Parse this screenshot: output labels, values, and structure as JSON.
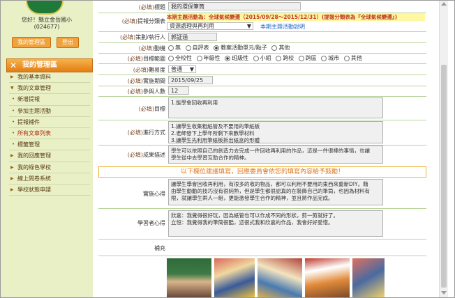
{
  "user": {
    "greeting": "您好！縣立金岳國小",
    "id": "(024677)"
  },
  "buttons": {
    "admin": "我的管理區",
    "logout": "登出"
  },
  "menu": {
    "title": "我的管理區",
    "items": [
      {
        "label": "我的基本資料",
        "type": "arrow",
        "color": "normal"
      },
      {
        "label": "我的文章管理",
        "type": "arrow-down",
        "color": "normal"
      },
      {
        "label": "新增提報",
        "type": "dot",
        "color": "normal"
      },
      {
        "label": "參加主題活動",
        "type": "dot",
        "color": "normal"
      },
      {
        "label": "提報補件",
        "type": "dot",
        "color": "normal"
      },
      {
        "label": "所有文章列表",
        "type": "dot",
        "color": "red"
      },
      {
        "label": "標籤管理",
        "type": "dot",
        "color": "normal"
      },
      {
        "label": "我的回應管理",
        "type": "arrow",
        "color": "normal"
      },
      {
        "label": "我的綠色學校",
        "type": "arrow",
        "color": "normal"
      },
      {
        "label": "線上問卷系統",
        "type": "arrow",
        "color": "normal"
      },
      {
        "label": "學校狀態申請",
        "type": "arrow",
        "color": "normal"
      }
    ]
  },
  "req": "(必填)",
  "form": {
    "title": {
      "label": "標題",
      "value": "我的環保筆筒"
    },
    "category": {
      "label": "提報分類表",
      "notice": "本期主題活動為：全球氣候變遷（2015/09/28～2015/12/31）(提報分類表為『全球氣候變遷』)",
      "select": "資源處理與再利用",
      "link": "本期主題活動說明"
    },
    "planner": {
      "label": "策劃/執行人",
      "value": "郭証涵"
    },
    "motive": {
      "label": "動機",
      "options": [
        "無",
        "自評表",
        "教案活動單元/點子",
        "其他"
      ],
      "selected": 2
    },
    "scope": {
      "label": "目標範圍",
      "options": [
        "全校性",
        "年級性",
        "班級性",
        "小組",
        "跨校",
        "跨區",
        "城市",
        "其他"
      ],
      "selected": 2
    },
    "difficulty": {
      "label": "難易度",
      "value": "普通"
    },
    "date": {
      "label": "實施期間",
      "value": "2015/09/25"
    },
    "people": {
      "label": "參與人數",
      "value": "12"
    },
    "goal": {
      "label": "目標",
      "value": "1.能學會回收再利用"
    },
    "method": {
      "label": "進行方式",
      "lines": [
        "1.讓學生收集粗紙管及不要用的筆紙板",
        "2.老師發下上學年所剩下來數學材料",
        "3.讓學生先利用筆紙板拆出紙盒的形體"
      ]
    },
    "result": {
      "label": "成果描述",
      "lines": [
        "學生可以依照自己的創造力去完成一件回收再利用的作品，這是一件很棒的事情，也讓",
        "學生從中去學習互助合作的精神。"
      ]
    },
    "fill_notice": "以下欄位建議填寫，回應委員會依您的填寫內容給予鼓勵！",
    "reflection": {
      "label": "實施心得",
      "lines": [
        "讓學生學會回收再利用，有很多的收的物品，都可以利用不要用的東西來重新DIY。藉",
        "由學生動動的技巧沒有很純熟，但是學生都很認真的在裝飾自己的筆筒，也因為材料有",
        "限，就讓學生兩人一組，更能激發學生合作的精神，並且將作品完成。"
      ]
    },
    "learner": {
      "label": "學習者心得",
      "lines": [
        "欣嘉：我覺得很好玩，因為紙管也可以作成不同的形狀，剪一剪就好了。",
        "立恒：我覺得我的筆筒很酷，這很式我和欣嘉的作品，我會好好愛惜。"
      ]
    },
    "supplement": {
      "label": "補充"
    }
  },
  "colors": {
    "accent": "#e27d12",
    "sidebar_bg": "#e9f0c6",
    "notice": "#e07a20"
  }
}
